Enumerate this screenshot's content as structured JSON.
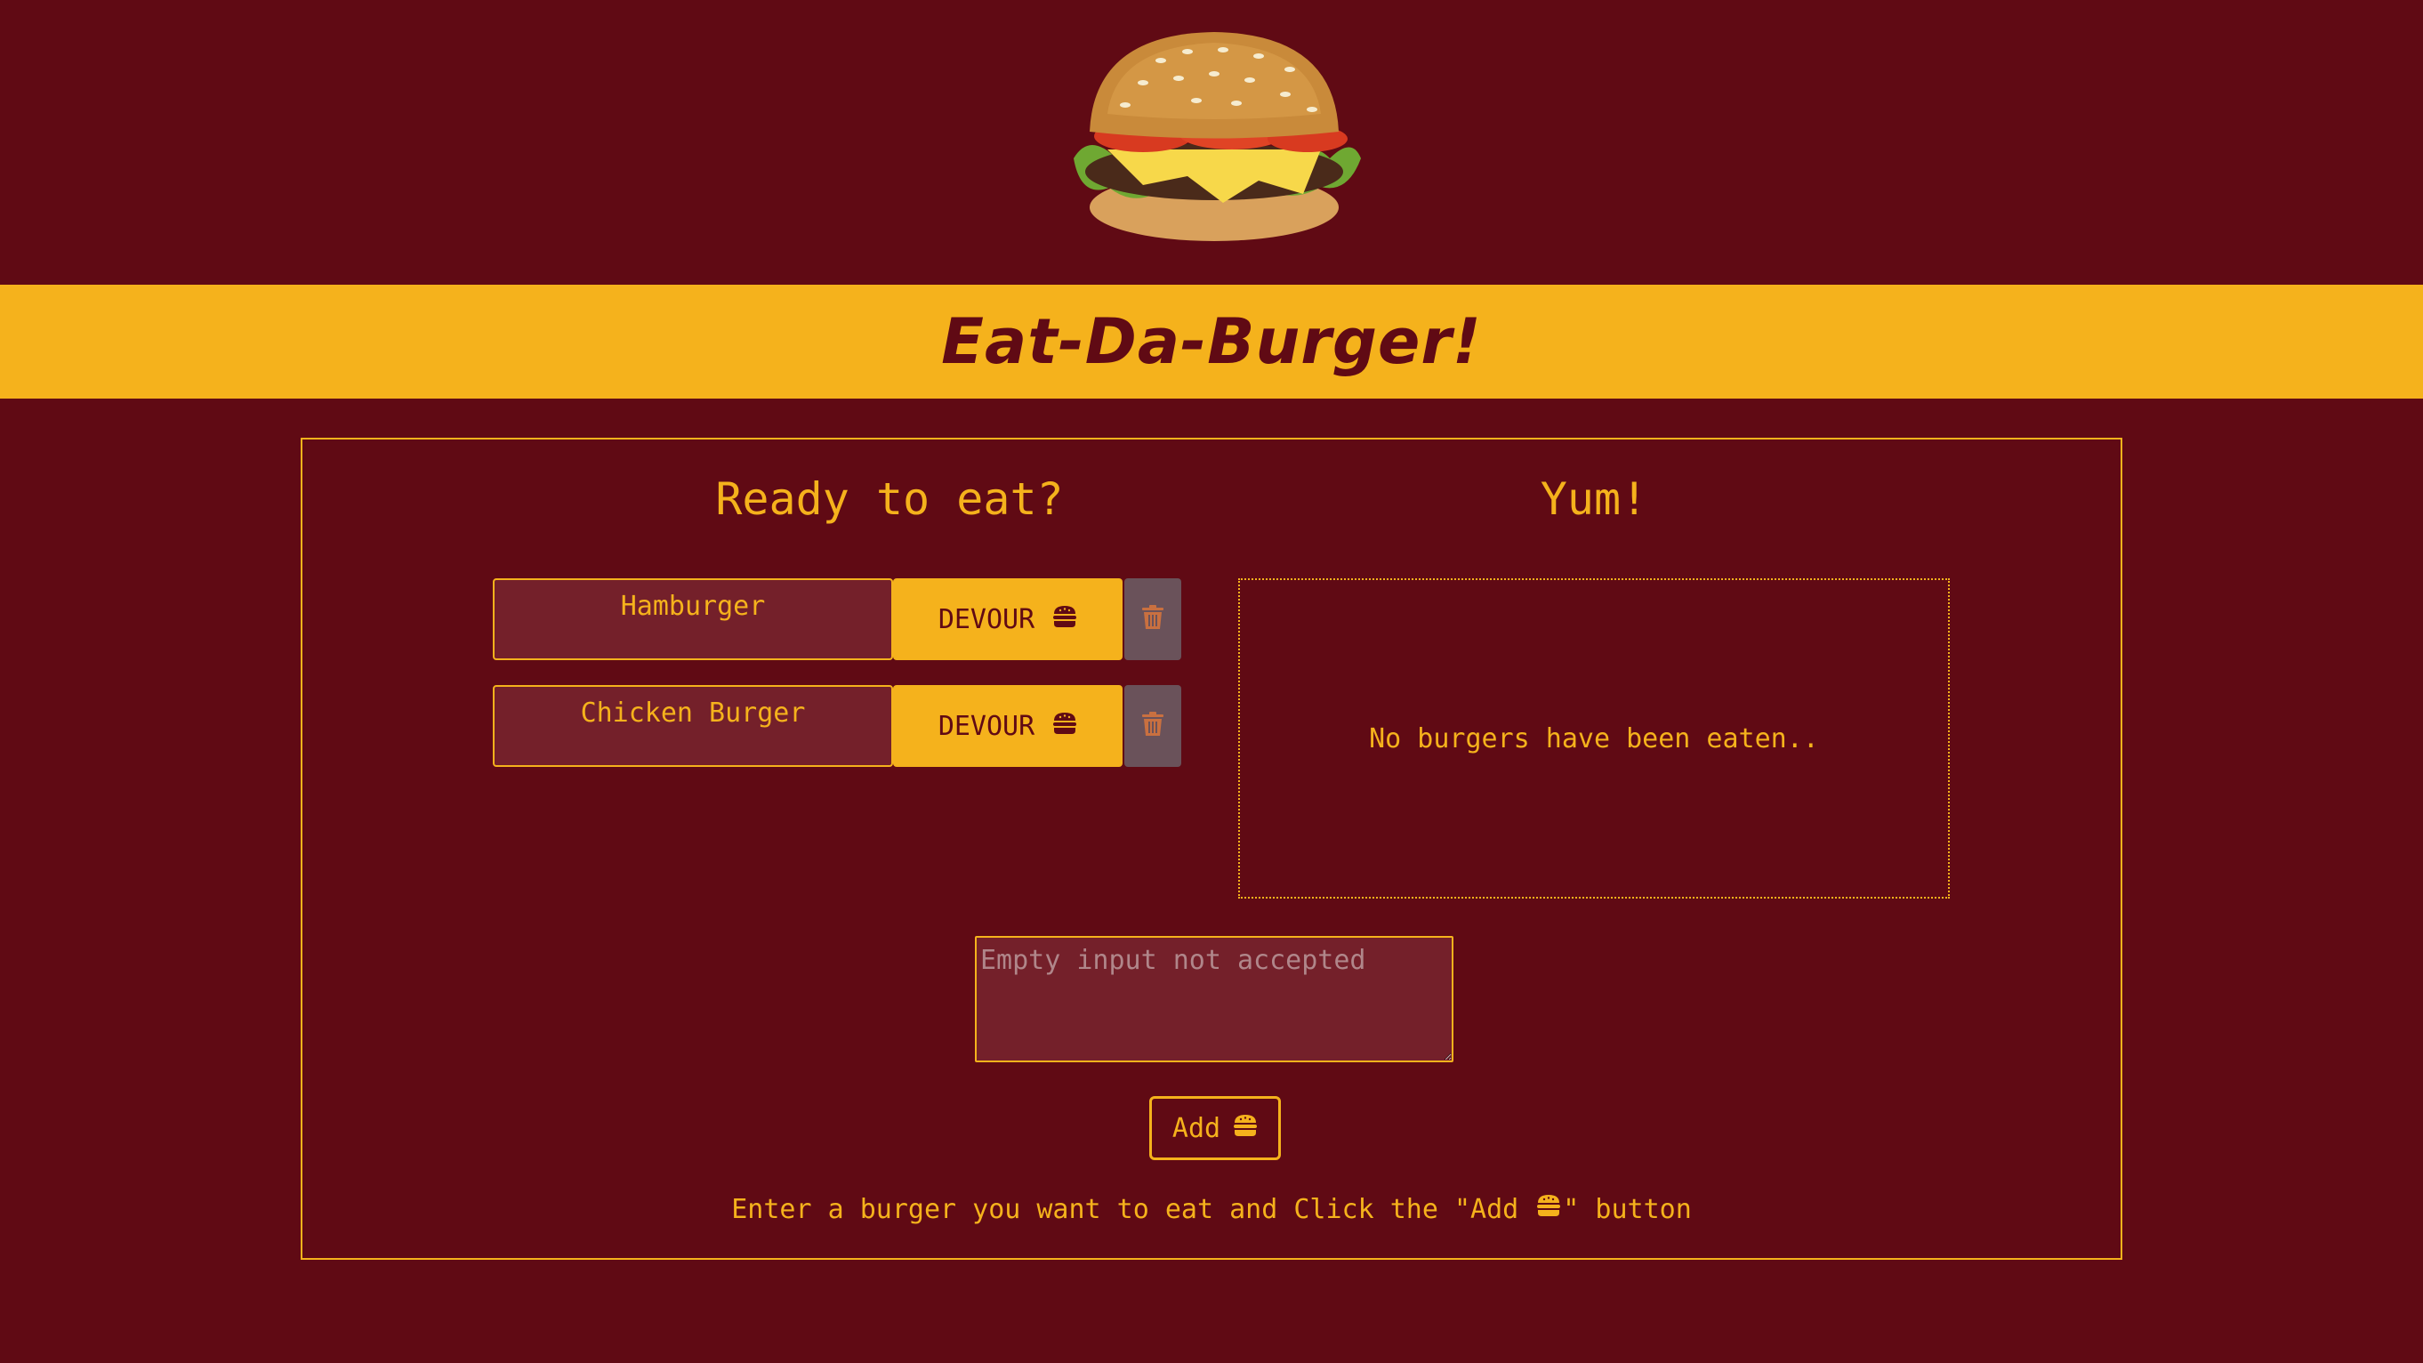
{
  "header": {
    "logo_icon": "burger-photo",
    "title": "Eat-Da-Burger!"
  },
  "left_column": {
    "title": "Ready to eat?",
    "burgers": [
      {
        "name": "Hamburger",
        "devour_label": "DEVOUR",
        "devour_icon": "hamburger-icon",
        "delete_icon": "trash-icon"
      },
      {
        "name": "Chicken Burger",
        "devour_label": "DEVOUR",
        "devour_icon": "hamburger-icon",
        "delete_icon": "trash-icon"
      }
    ]
  },
  "right_column": {
    "title": "Yum!",
    "empty_message": "No burgers have been eaten.."
  },
  "form": {
    "input_value": "",
    "input_placeholder": "Empty input not accepted",
    "add_label": "Add",
    "add_icon": "hamburger-icon",
    "instructions_before": "Enter a burger you want to eat and Click the \"Add",
    "instructions_after": "\" button"
  },
  "colors": {
    "background": "#600a14",
    "accent": "#f5b21c",
    "input_bg": "#74202a",
    "trash_bg": "#6a525a"
  }
}
